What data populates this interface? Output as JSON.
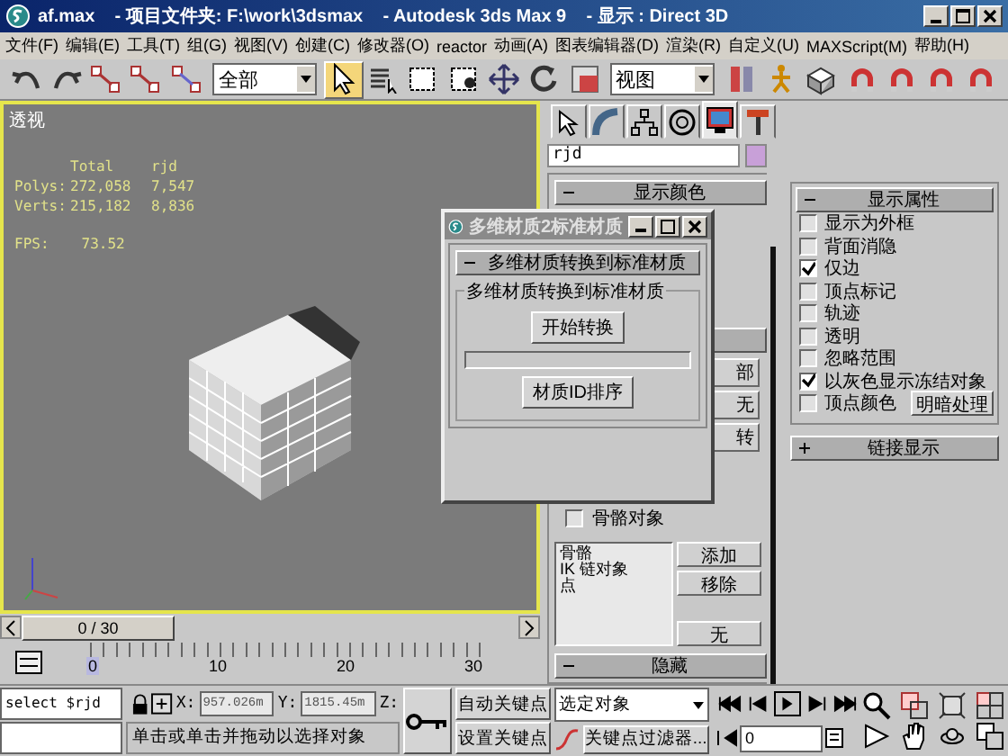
{
  "window": {
    "title": "af.max    - 项目文件夹: F:\\work\\3dsmax    - Autodesk 3ds Max 9    - 显示 : Direct 3D"
  },
  "menu": [
    "文件(F)",
    "编辑(E)",
    "工具(T)",
    "组(G)",
    "视图(V)",
    "创建(C)",
    "修改器(O)",
    "reactor",
    "动画(A)",
    "图表编辑器(D)",
    "渲染(R)",
    "自定义(U)",
    "MAXScript(M)",
    "帮助(H)"
  ],
  "toolbar": [
    {
      "kind": "undo",
      "selected": false
    },
    {
      "kind": "redo",
      "selected": false
    },
    {
      "kind": "link",
      "selected": false
    },
    {
      "kind": "unlink",
      "selected": false
    },
    {
      "kind": "bind",
      "selected": false
    },
    {
      "kind": "dropdown",
      "value": "全部"
    },
    {
      "kind": "select",
      "selected": true
    },
    {
      "kind": "list",
      "selected": false
    },
    {
      "kind": "region",
      "selected": false
    },
    {
      "kind": "crossing",
      "selected": false
    },
    {
      "kind": "move",
      "selected": false
    },
    {
      "kind": "rotate",
      "selected": false
    },
    {
      "kind": "scale",
      "selected": false
    },
    {
      "kind": "dropdown",
      "value": "视图"
    },
    {
      "kind": "pivot",
      "selected": false
    },
    {
      "kind": "manipulate",
      "selected": false
    },
    {
      "kind": "keyboard",
      "selected": false
    },
    {
      "kind": "snap",
      "selected": false
    },
    {
      "kind": "snap",
      "selected": false
    },
    {
      "kind": "snap",
      "selected": false
    },
    {
      "kind": "snap",
      "selected": false
    }
  ],
  "viewport": {
    "label": "透视",
    "stats_header": [
      "Total",
      "rjd"
    ],
    "stats_rows": [
      [
        "Polys:",
        "272,058",
        "7,547"
      ],
      [
        "Verts:",
        "215,182",
        "8,836"
      ]
    ],
    "fps": [
      "FPS:",
      "73.52"
    ]
  },
  "dialog": {
    "title": "多维材质2标准材质",
    "rollout": {
      "title": "多维材质转换到标准材质",
      "expanded": true
    },
    "group": "多维材质转换到标准材质",
    "buttons": [
      "开始转换",
      "材质ID排序"
    ],
    "progress": {
      "level": 0
    }
  },
  "command_panel": {
    "tabs": [
      {
        "kind": "create",
        "selected": false
      },
      {
        "kind": "modify",
        "selected": false
      },
      {
        "kind": "hierarchy",
        "selected": false
      },
      {
        "kind": "motion",
        "selected": false
      },
      {
        "kind": "display",
        "selected": true
      },
      {
        "kind": "utilities",
        "selected": false
      }
    ],
    "object_name": "rjd",
    "left": {
      "color_rollout": {
        "title": "显示颜色",
        "expanded": true
      },
      "partial_buttons": [
        "部",
        "无",
        "转"
      ],
      "bone_checkbox": {
        "label": "骨骼对象",
        "checked": false
      },
      "list": [
        "骨骼",
        "IK 链对象",
        "点"
      ],
      "list_buttons": [
        "添加",
        "移除",
        "无"
      ],
      "hide_rollout": {
        "title": "隐藏",
        "expanded": true
      }
    },
    "right": {
      "properties_rollout": {
        "title": "显示属性",
        "expanded": true
      },
      "checkboxes": [
        {
          "label": "显示为外框",
          "checked": false
        },
        {
          "label": "背面消隐",
          "checked": false
        },
        {
          "label": "仅边",
          "checked": true
        },
        {
          "label": "顶点标记",
          "checked": false
        },
        {
          "label": "轨迹",
          "checked": false
        },
        {
          "label": "透明",
          "checked": false
        },
        {
          "label": "忽略范围",
          "checked": false
        },
        {
          "label": "以灰色显示冻结对象",
          "checked": true
        },
        {
          "label": "顶点颜色",
          "checked": false
        }
      ],
      "shading_button": "明暗处理",
      "link_rollout": {
        "title": "链接显示",
        "expanded": false
      }
    }
  },
  "time_slider": {
    "label": "0 / 30",
    "level": 0
  },
  "track_ticks": [
    "0",
    "10",
    "20",
    "30"
  ],
  "status": {
    "script_line": "select $rjd",
    "x_label": "X:",
    "x": "957.026m",
    "y_label": "Y:",
    "y": "1815.45m",
    "z_label": "Z:",
    "prompt": "单击或单击并拖动以选择对象",
    "auto_key": "自动关键点",
    "set_key": "设置关键点",
    "key_set": "选定对象",
    "key_filters": "关键点过滤器...",
    "frame": "0"
  }
}
